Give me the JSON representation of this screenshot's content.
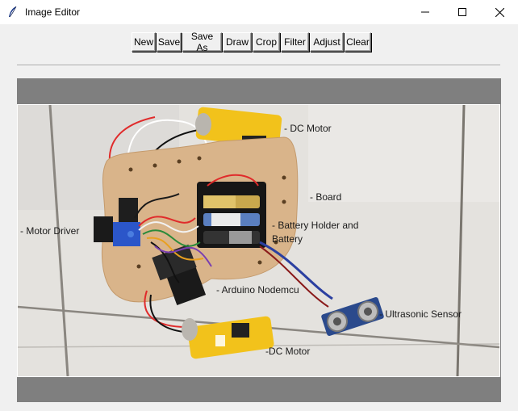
{
  "window": {
    "title": "Image Editor",
    "app_icon": "feather-icon",
    "controls": {
      "minimize": "minimize-icon",
      "maximize": "maximize-icon",
      "close": "close-icon"
    }
  },
  "toolbar": {
    "buttons": [
      "New",
      "Save",
      "Save As",
      "Draw",
      "Crop",
      "Filter",
      "Adjust",
      "Clear"
    ]
  },
  "photo": {
    "annotations": {
      "dc_motor_top": "- DC Motor",
      "board": "- Board",
      "battery_holder_line1": "- Battery Holder and",
      "battery_holder_line2": "Battery",
      "motor_driver": "- Motor Driver",
      "arduino": "- Arduino Nodemcu",
      "ultrasonic": "- Ultrasonic Sensor",
      "dc_motor_bottom": "-DC Motor"
    }
  },
  "colors": {
    "canvas_bg": "#7f7f7f",
    "motor": "#f2c21b",
    "board": "#d9b48a",
    "sensor": "#2b4a8c"
  }
}
